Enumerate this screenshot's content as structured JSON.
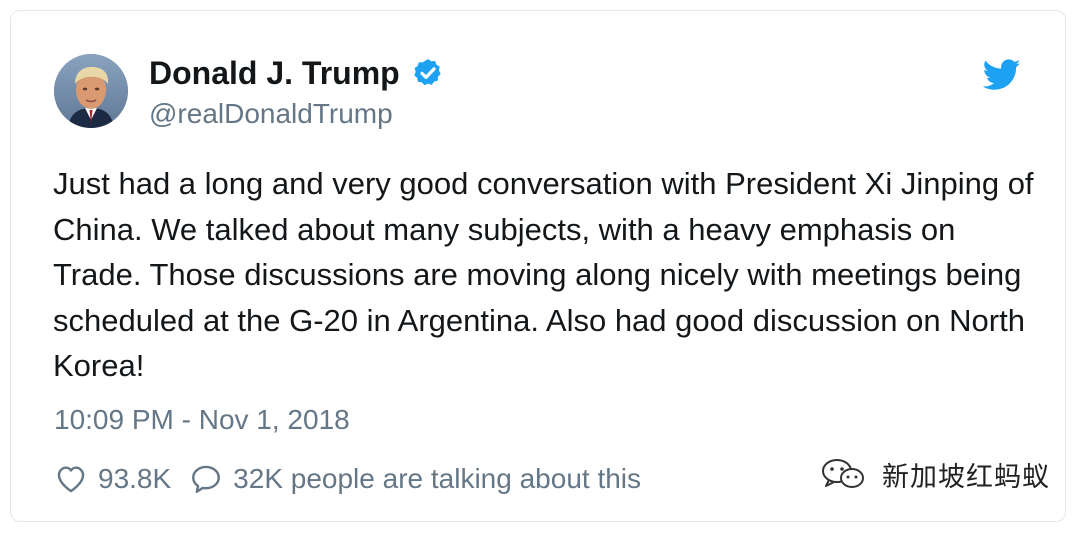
{
  "tweet": {
    "author": {
      "display_name": "Donald J. Trump",
      "handle": "@realDonaldTrump",
      "verified": true
    },
    "text": "Just had a long and very good conversation with President Xi Jinping of China. We talked about many subjects, with a heavy emphasis on Trade. Those discussions are moving along nicely with meetings being scheduled at the G-20 in Argentina. Also had good discussion on North Korea!",
    "timestamp": "10:09 PM - Nov 1, 2018",
    "likes": "93.8K",
    "talking": "32K people are talking about this"
  },
  "watermark": {
    "text": "新加坡红蚂蚁"
  },
  "icons": {
    "verified": "verified-badge-icon",
    "brand": "twitter-bird-icon",
    "like": "heart-outline-icon",
    "reply": "speech-bubble-icon",
    "watermark_logo": "wechat-logo-icon"
  },
  "colors": {
    "brand_blue": "#1da1f2",
    "text_primary": "#14171a",
    "text_secondary": "#657786",
    "border": "#e1e8ed"
  }
}
